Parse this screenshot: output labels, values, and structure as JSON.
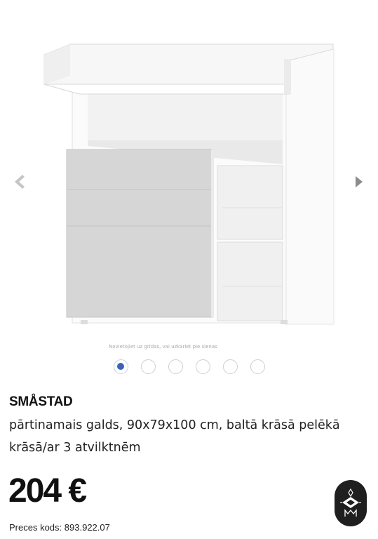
{
  "gallery": {
    "image_alt": "SMÅSTAD pārtinamais galds",
    "nav_prev_icon": "chevron-left-icon",
    "nav_next_icon": "chevron-right-icon",
    "slide_count": 6,
    "active_slide": 1
  },
  "product": {
    "name": "SMÅSTAD",
    "description": "pārtinamais galds, 90x79x100 cm, baltā krāsā pelēkā krāsā/ar 3 atvilktnēm",
    "price": "204 €",
    "code_label": "Preces kods:",
    "code_value": "893.922.07"
  },
  "colors": {
    "accent": "#3d63b8",
    "drawer_grey": "#d6d6d6",
    "fab_bg": "#1f1f1f"
  },
  "fab": {
    "icon": "ornament-icon"
  }
}
